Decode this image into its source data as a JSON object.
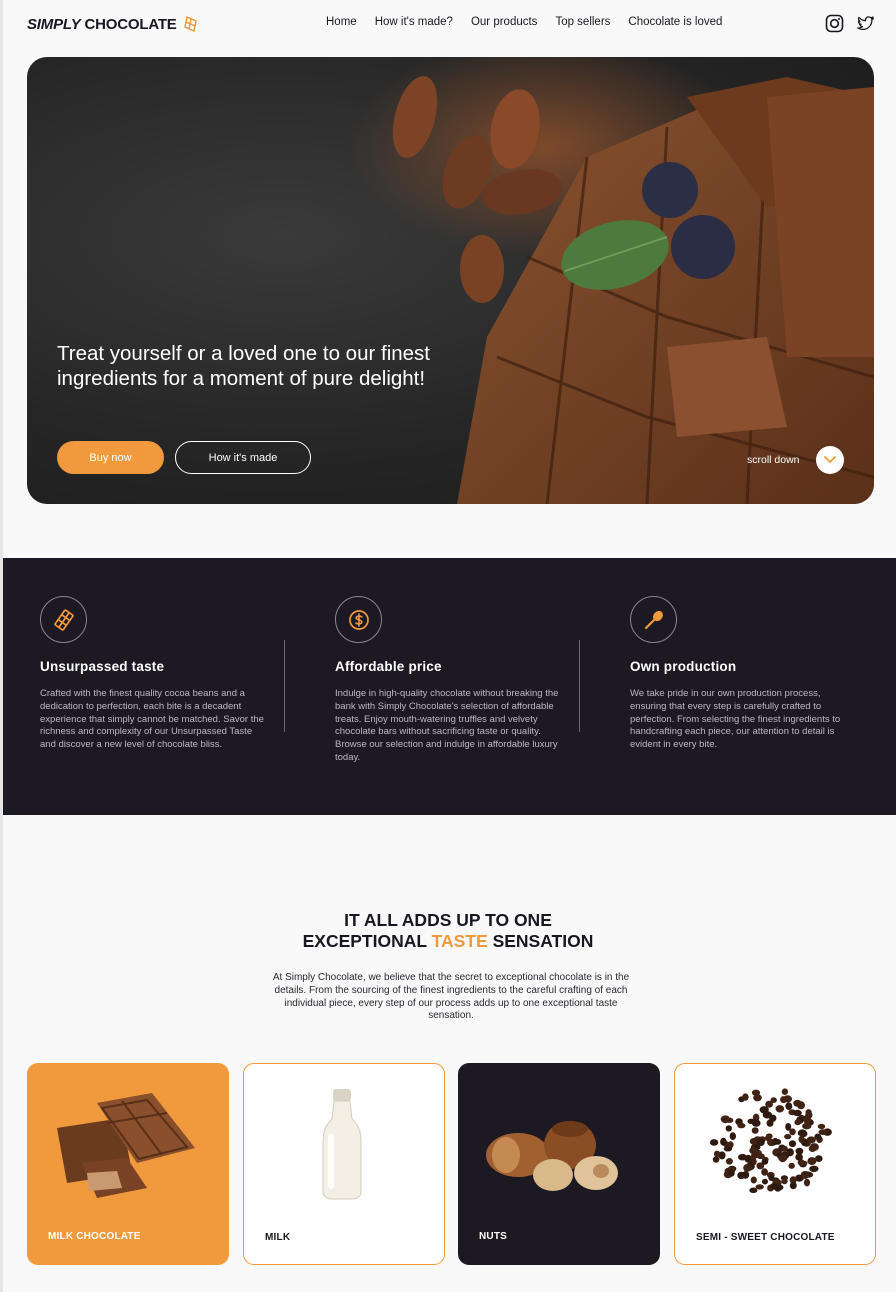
{
  "brand": {
    "name_part1": "SIMPLY",
    "name_part2": "CHOCOLATE",
    "accent": "#f0993d",
    "dark": "#1d1923"
  },
  "nav": {
    "items": [
      "Home",
      "How it's made?",
      "Our products",
      "Top sellers",
      "Chocolate is loved"
    ]
  },
  "socials": {
    "icons": [
      "instagram-icon",
      "twitter-icon"
    ]
  },
  "hero": {
    "title": "Treat yourself or a loved one to our finest ingredients for a moment of pure delight!",
    "buy_label": "Buy now",
    "how_label": "How it's made",
    "scroll_label": "scroll down"
  },
  "features": [
    {
      "icon": "chocolate-bar-icon",
      "title": "Unsurpassed taste",
      "text": "Crafted with the finest quality cocoa beans and a dedication to perfection, each bite is a decadent experience that simply cannot be matched. Savor the richness and complexity of our Unsurpassed Taste and discover a new level of chocolate bliss."
    },
    {
      "icon": "dollar-coin-icon",
      "title": "Affordable price",
      "text": "Indulge in high-quality chocolate without breaking the bank with Simply Chocolate's selection of affordable treats. Enjoy mouth-watering truffles and velvety chocolate bars without sacrificing taste or quality. Browse our selection and indulge in affordable luxury today."
    },
    {
      "icon": "spoon-icon",
      "title": "Own production",
      "text": "We take pride in our own production process, ensuring that every step is carefully crafted to perfection. From selecting the finest ingredients to handcrafting each piece, our attention to detail is evident in every bite."
    }
  ],
  "section": {
    "title_line1": "IT ALL ADDS UP TO ONE",
    "title_line2_pre": "EXCEPTIONAL ",
    "title_line2_accent": "TASTE",
    "title_line2_post": " SENSATION",
    "text": "At Simply Chocolate, we believe that the secret to exceptional chocolate is in the details. From the sourcing of the finest ingredients to the careful crafting of each individual piece, every step of our process adds up to one exceptional taste sensation."
  },
  "cards": [
    {
      "label": "MILK CHOCOLATE"
    },
    {
      "label": "MILK"
    },
    {
      "label": "NUTS"
    },
    {
      "label": "SEMI - SWEET CHOCOLATE"
    }
  ]
}
